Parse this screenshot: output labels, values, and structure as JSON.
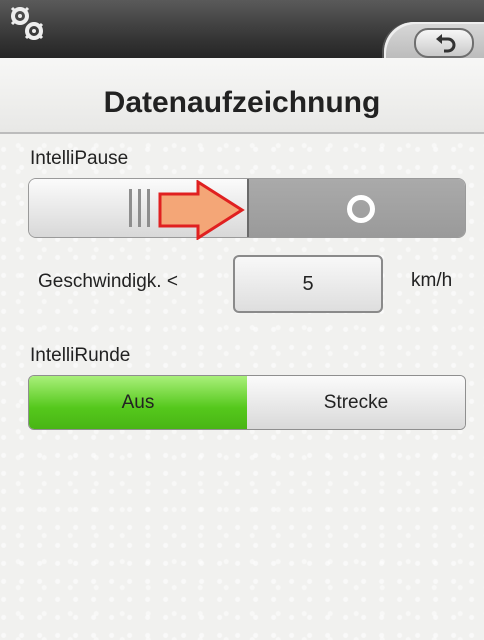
{
  "header": {
    "settings_icon": "settings-gears-icon",
    "back_icon": "back-arrow-icon"
  },
  "title": "Datenaufzeichnung",
  "intellipause": {
    "label": "IntelliPause",
    "state": "on"
  },
  "speed": {
    "label": "Geschwindigk. <",
    "value": "5",
    "unit": "km/h"
  },
  "intellirunde": {
    "label": "IntelliRunde",
    "options": [
      "Aus",
      "Strecke"
    ],
    "selected": "Aus"
  },
  "colors": {
    "selected_green": "#55c81c",
    "arrow_fill": "#f4a677",
    "arrow_outline": "#e02020"
  }
}
